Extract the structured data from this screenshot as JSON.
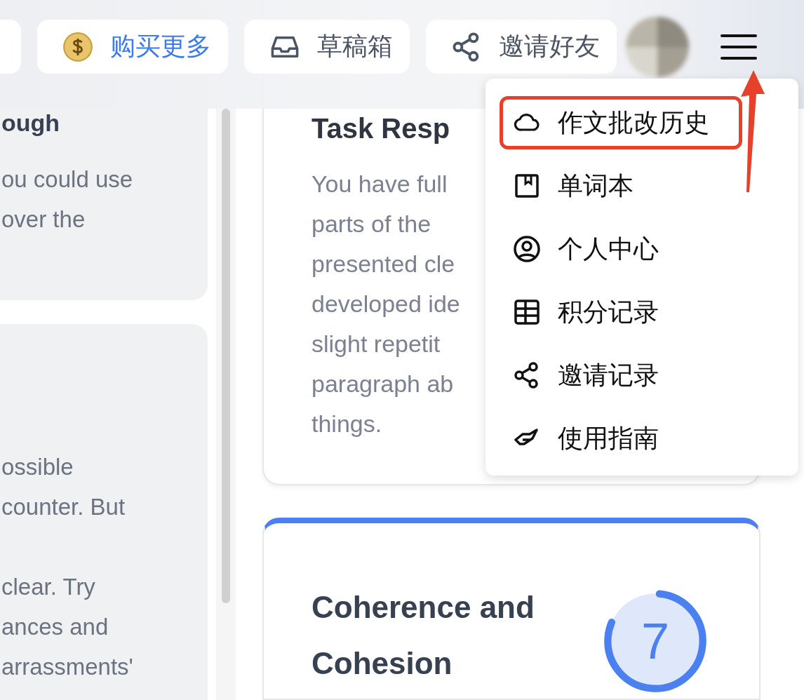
{
  "toolbar": {
    "buttons": [
      {
        "kind": "stub"
      },
      {
        "kind": "coin",
        "label": "购买更多"
      },
      {
        "kind": "inbox",
        "label": "草稿箱"
      },
      {
        "kind": "share",
        "label": "邀请好友"
      }
    ]
  },
  "left_cards": [
    {
      "heading": "ough",
      "paragraphs": [
        [
          "ou could use",
          "over the"
        ]
      ]
    },
    {
      "paragraphs": [
        [
          "ossible",
          "counter. But"
        ],
        [
          "clear. Try",
          "ances and",
          "arrassments'"
        ]
      ]
    }
  ],
  "task_card": {
    "heading": "Task Resp",
    "lines": [
      "You have full",
      "parts of the",
      "presented cle",
      "developed ide",
      "slight repetit",
      "paragraph ab",
      "things."
    ]
  },
  "score_card": {
    "heading": "Coherence and Cohesion",
    "score": "7",
    "level": 0.8
  },
  "menu": {
    "items": [
      {
        "kind": "cloud",
        "label": "作文批改历史",
        "highlighted": true
      },
      {
        "kind": "book",
        "label": "单词本",
        "highlighted": false
      },
      {
        "kind": "user",
        "label": "个人中心",
        "highlighted": false
      },
      {
        "kind": "table",
        "label": "积分记录",
        "highlighted": false
      },
      {
        "kind": "share",
        "label": "邀请记录",
        "highlighted": false
      },
      {
        "kind": "hand",
        "label": "使用指南",
        "highlighted": false
      }
    ]
  }
}
